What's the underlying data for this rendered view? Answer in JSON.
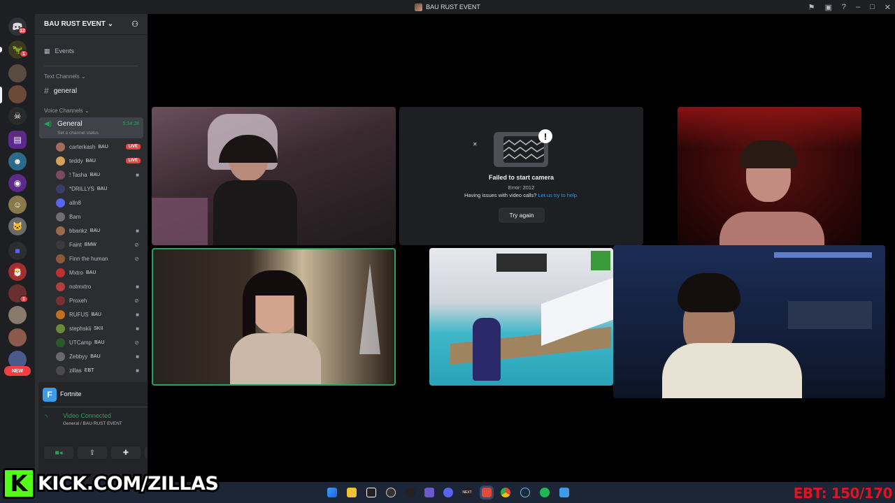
{
  "window": {
    "title": "BAU RUST EVENT"
  },
  "servers": {
    "notification_count": "12",
    "new_label": "NEW"
  },
  "server": {
    "name": "BAU RUST EVENT"
  },
  "nav": {
    "events": "Events"
  },
  "text_channels": {
    "category": "Text Channels",
    "general": "general"
  },
  "voice_channels": {
    "category": "Voice Channels",
    "channel": "General",
    "timer": "5:34:28",
    "status_hint": "Set a channel status",
    "members": [
      {
        "name": "carterkash",
        "tag": "BAU",
        "state": "LIVE",
        "color": "#a26b5a"
      },
      {
        "name": "teddy",
        "tag": "BAU",
        "state": "LIVE",
        "color": "#d4a15a"
      },
      {
        "name": "! Tasha",
        "tag": "BAU",
        "state": "cam",
        "color": "#7a4a60"
      },
      {
        "name": "*DRILLYS",
        "tag": "BAU",
        "state": "",
        "color": "#3c3c6a"
      },
      {
        "name": "alln8",
        "tag": "",
        "state": "",
        "color": "#5865f2"
      },
      {
        "name": "Bam",
        "tag": "",
        "state": "",
        "color": "#6f6f6f"
      },
      {
        "name": "bbankz",
        "tag": "BAU",
        "state": "cam",
        "color": "#9a6a4a"
      },
      {
        "name": "Faint",
        "tag": "BMW",
        "state": "muted",
        "color": "#3a3a3a"
      },
      {
        "name": "Finn the human",
        "tag": "",
        "state": "muted",
        "color": "#8a5a3a"
      },
      {
        "name": "Mxtro",
        "tag": "BAU",
        "state": "",
        "color": "#c03030"
      },
      {
        "name": "notmxtro",
        "tag": "",
        "state": "cam",
        "color": "#b04040"
      },
      {
        "name": "Proxeh",
        "tag": "",
        "state": "muted",
        "color": "#7a3030"
      },
      {
        "name": "RUFUS",
        "tag": "BAU",
        "state": "cam",
        "color": "#c07020"
      },
      {
        "name": "stephskii",
        "tag": "SKII",
        "state": "cam",
        "color": "#6a8a3a"
      },
      {
        "name": "UTCamp",
        "tag": "BAU",
        "state": "muted",
        "color": "#2a5a2a"
      },
      {
        "name": "Zebbyy",
        "tag": "BAU",
        "state": "cam",
        "color": "#6a6a6a"
      },
      {
        "name": "zillas",
        "tag": "EBT",
        "state": "cam",
        "color": "#4a4a4a"
      }
    ]
  },
  "activity": {
    "game": "Fortnite"
  },
  "voice_panel": {
    "status": "Video Connected",
    "location": "General / BAU RUST EVENT"
  },
  "camera_error": {
    "title": "Failed to start camera",
    "code": "Error: 2012",
    "help_prefix": "Having issues with video calls?",
    "help_link": "Let us try to help.",
    "retry": "Try again"
  },
  "overlay": {
    "kick_url": "KICK.COM/ZILLAS",
    "ebt_counter": "EBT: 150/170"
  },
  "colors": {
    "accent": "#5865f2",
    "connected": "#23a55a",
    "live": "#f23f43",
    "kick": "#53fc18"
  }
}
